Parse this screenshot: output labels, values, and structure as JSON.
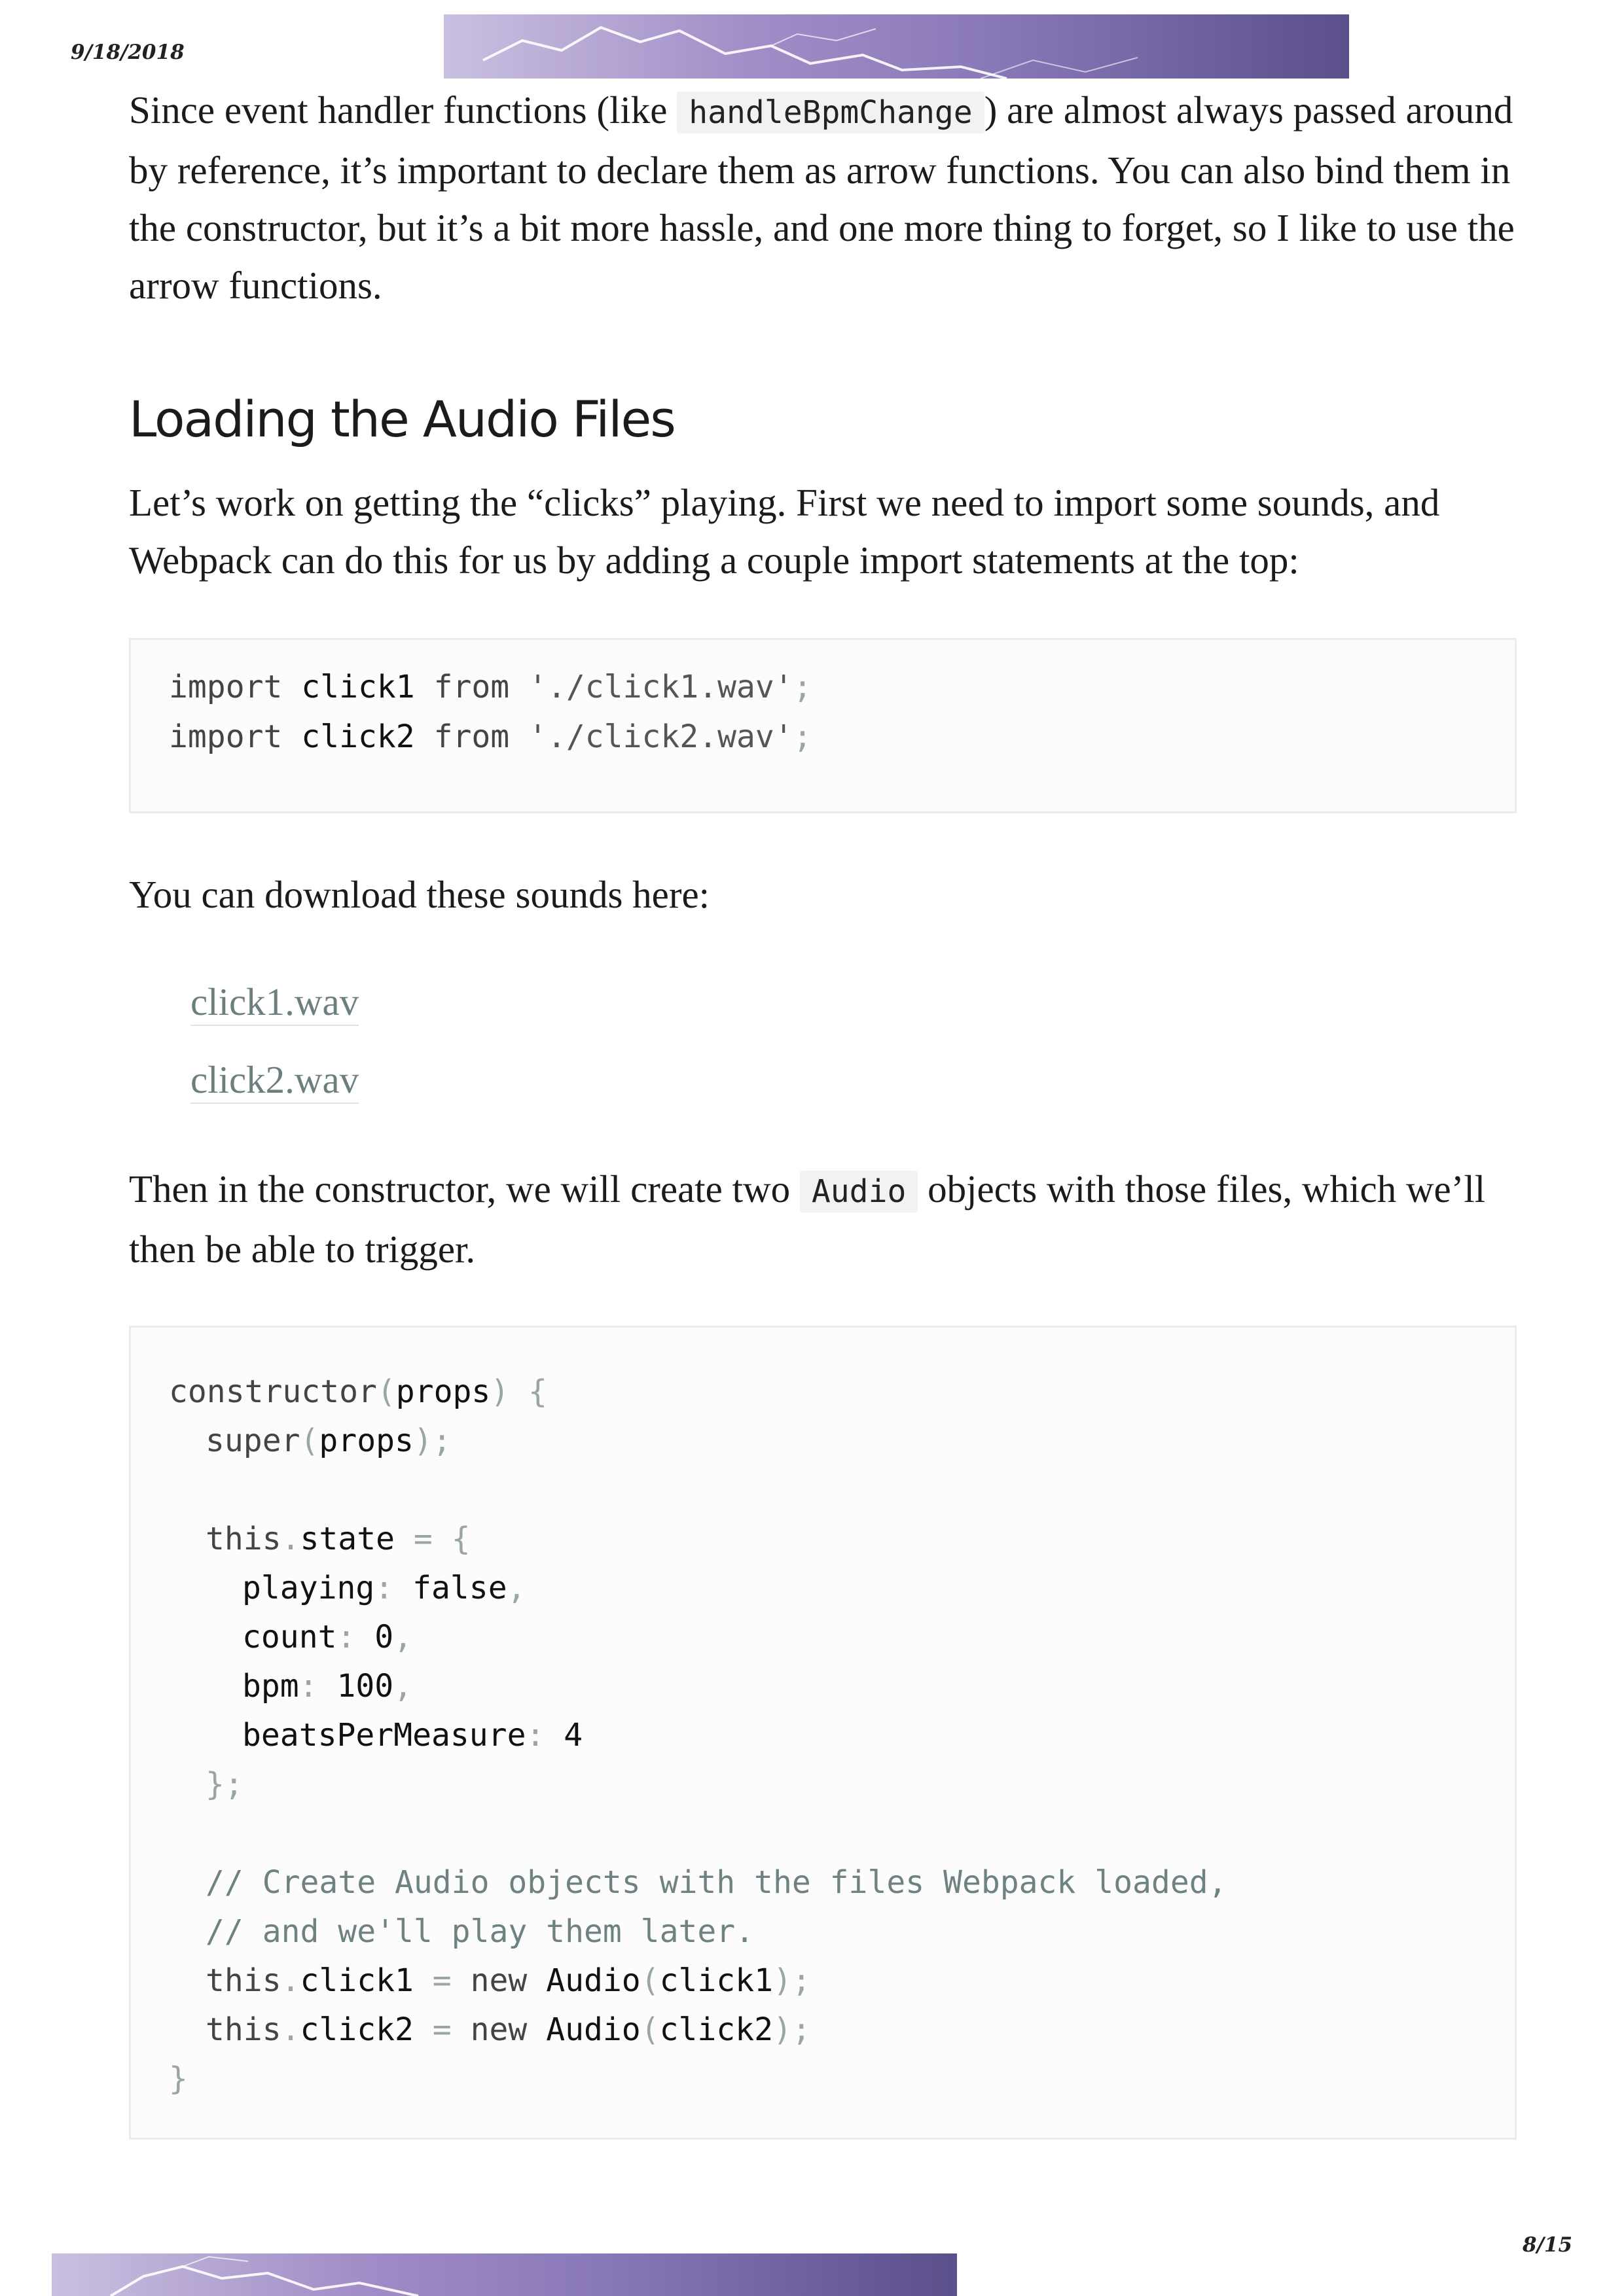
{
  "header": {
    "date": "9/18/2018"
  },
  "footer": {
    "page": "8/15"
  },
  "intro": {
    "text_before": "Since event handler functions (like ",
    "code": "handleBpmChange",
    "text_after": ") are almost always passed around by reference, it’s important to declare them as arrow functions. You can also bind them in the constructor, but it’s a bit more hassle, and one more thing to forget, so I like to use the arrow functions."
  },
  "section": {
    "heading": "Loading the Audio Files"
  },
  "para_import": "Let’s work on getting the “clicks” playing. First we need to import some sounds, and Webpack can do this for us by adding a couple import statements at the top:",
  "code1": {
    "l1": {
      "kw": "import",
      "id": "click1",
      "from": "from",
      "str": "'./click1.wav'",
      "end": ";"
    },
    "l2": {
      "kw": "import",
      "id": "click2",
      "from": "from",
      "str": "'./click2.wav'",
      "end": ";"
    }
  },
  "para_download": "You can download these sounds here:",
  "links": {
    "click1": "click1.wav",
    "click2": "click2.wav"
  },
  "para_constructor": {
    "text_before": "Then in the constructor, we will create two ",
    "code": "Audio",
    "text_after": " objects with those files, which we’ll then be able to trigger."
  },
  "code2": {
    "lines": {
      "l1a": "constructor",
      "l1b": "(",
      "l1c": "props",
      "l1d": ") {",
      "l2a": "super",
      "l2b": "(",
      "l2c": "props",
      "l2d": ");",
      "l4a": "this",
      "l4b": ".",
      "l4c": "state",
      "l4d": " = {",
      "l5a": "playing",
      "l5b": ":",
      "l5c": " false",
      "l5d": ",",
      "l6a": "count",
      "l6b": ":",
      "l6c": " 0",
      "l6d": ",",
      "l7a": "bpm",
      "l7b": ":",
      "l7c": " 100",
      "l7d": ",",
      "l8a": "beatsPerMeasure",
      "l8b": ":",
      "l8c": " 4",
      "l9": "};",
      "l11": "// Create Audio objects with the files Webpack loaded,",
      "l12": "// and we'll play them later.",
      "l13a": "this",
      "l13b": ".",
      "l13c": "click1",
      "l13d": " = ",
      "l13e": "new",
      "l13f": " Audio",
      "l13g": "(",
      "l13h": "click1",
      "l13i": ");",
      "l14a": "this",
      "l14b": ".",
      "l14c": "click2",
      "l14d": " = ",
      "l14e": "new",
      "l14f": " Audio",
      "l14g": "(",
      "l14h": "click2",
      "l14i": ");",
      "l15": "}"
    }
  },
  "colors": {
    "banner_light": "#c9c0e0",
    "banner_dark": "#5b4f8c",
    "link": "#6c7f7f",
    "code_bg": "#fcfcfc"
  }
}
